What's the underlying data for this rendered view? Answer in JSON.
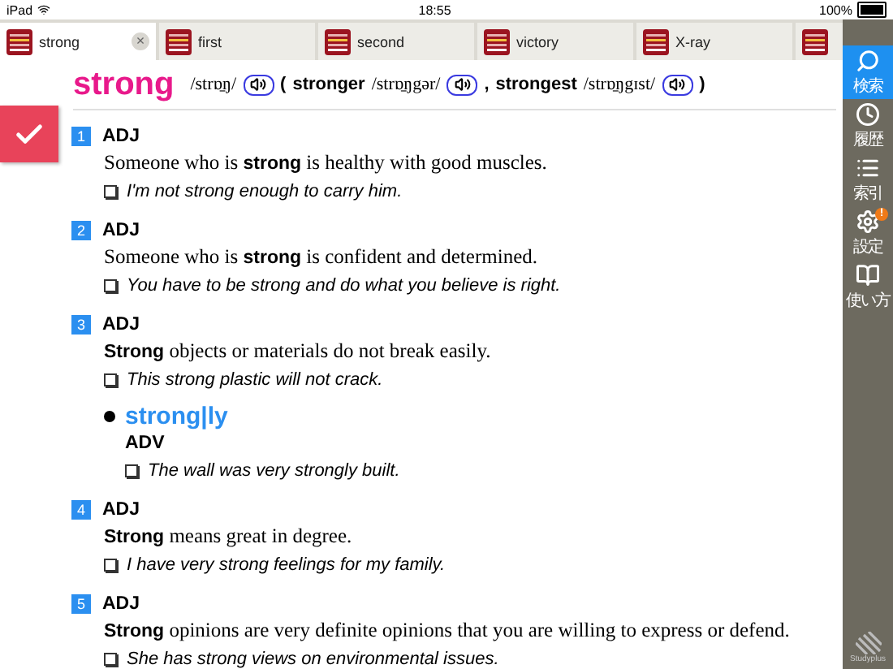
{
  "status_bar": {
    "device": "iPad",
    "time": "18:55",
    "battery": "100%"
  },
  "tabs": [
    {
      "label": "strong",
      "selected": true,
      "close": "×"
    },
    {
      "label": "first",
      "selected": false
    },
    {
      "label": "second",
      "selected": false
    },
    {
      "label": "victory",
      "selected": false
    },
    {
      "label": "X-ray",
      "selected": false
    },
    {
      "selected": false
    }
  ],
  "sidebar": {
    "items": [
      {
        "label": "検索",
        "selected": true
      },
      {
        "label": "履歴",
        "selected": false
      },
      {
        "label": "索引",
        "selected": false
      },
      {
        "label": "設定",
        "selected": false,
        "badge": "!"
      },
      {
        "label": "使い方",
        "selected": false
      }
    ],
    "logo": "Studyplus"
  },
  "entry": {
    "headword": "strong",
    "pron": "/strɒ̱ŋ/",
    "open": "(",
    "forms": [
      {
        "word": "stronger",
        "pron": "/strɒ̱ŋgər/",
        "sep": ","
      },
      {
        "word": "strongest",
        "pron": "/strɒ̱ŋgɪst/"
      }
    ],
    "close": ")",
    "checked": true,
    "senses": [
      {
        "number": "1",
        "pos": "ADJ",
        "definition": "Someone who is **strong** is healthy with good muscles.",
        "example": "I'm not strong enough to carry him."
      },
      {
        "number": "2",
        "pos": "ADJ",
        "definition": "Someone who is **strong** is confident and determined.",
        "example": "You have to be strong and do what you believe is right."
      },
      {
        "number": "3",
        "pos": "ADJ",
        "definition": "**Strong** objects or materials do not break easily.",
        "example": "This strong plastic will not crack.",
        "derived": {
          "word": "strong|ly",
          "pos": "ADV",
          "example": "The wall was very strongly built."
        }
      },
      {
        "number": "4",
        "pos": "ADJ",
        "definition": "**Strong** means great in degree.",
        "example": "I have very strong feelings for my family."
      },
      {
        "number": "5",
        "pos": "ADJ",
        "definition": "**Strong** opinions are very definite opinions that you are willing to express or defend.",
        "example": "She has strong views on environmental issues."
      }
    ]
  }
}
